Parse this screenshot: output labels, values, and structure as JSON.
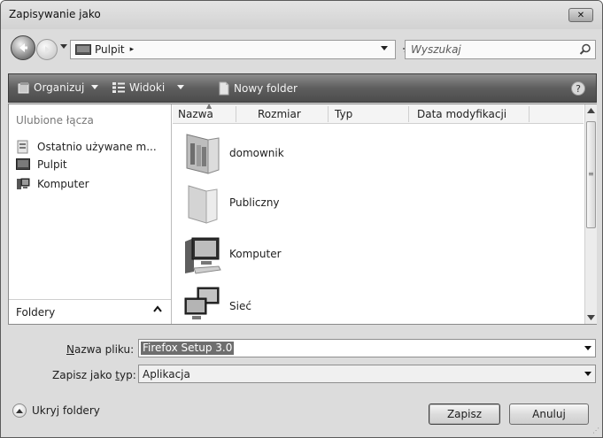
{
  "window": {
    "title": "Zapisywanie jako",
    "close_glyph": "✕"
  },
  "nav": {
    "address_location": "Pulpit",
    "address_separator": "▸",
    "search_placeholder": "Wyszukaj"
  },
  "toolbar": {
    "organize_label": "Organizuj",
    "views_label": "Widoki",
    "new_folder_label": "Nowy folder"
  },
  "favorites": {
    "header": "Ulubione łącza",
    "items": [
      {
        "label": "Ostatnio używane m...",
        "icon": "recent-places-icon"
      },
      {
        "label": "Pulpit",
        "icon": "desktop-icon"
      },
      {
        "label": "Komputer",
        "icon": "computer-icon"
      }
    ],
    "folders_label": "Foldery"
  },
  "file_list": {
    "columns": [
      "Nazwa",
      "Rozmiar",
      "Typ",
      "Data modyfikacji"
    ],
    "rows": [
      {
        "name": "domownik",
        "icon": "user-folder-icon"
      },
      {
        "name": "Publiczny",
        "icon": "folder-icon"
      },
      {
        "name": "Komputer",
        "icon": "computer-icon"
      },
      {
        "name": "Sieć",
        "icon": "network-icon"
      }
    ]
  },
  "form": {
    "filename_label_prefix": "N",
    "filename_label_rest": "azwa pliku:",
    "filename_value": "Firefox Setup 3.0",
    "type_label_prefix": "Zapisz jako ",
    "type_label_underlined": "t",
    "type_label_rest": "yp:",
    "type_value": "Aplikacja"
  },
  "footer": {
    "hide_folders_label": "Ukryj foldery",
    "save_label": "Zapisz",
    "cancel_label": "Anuluj"
  }
}
